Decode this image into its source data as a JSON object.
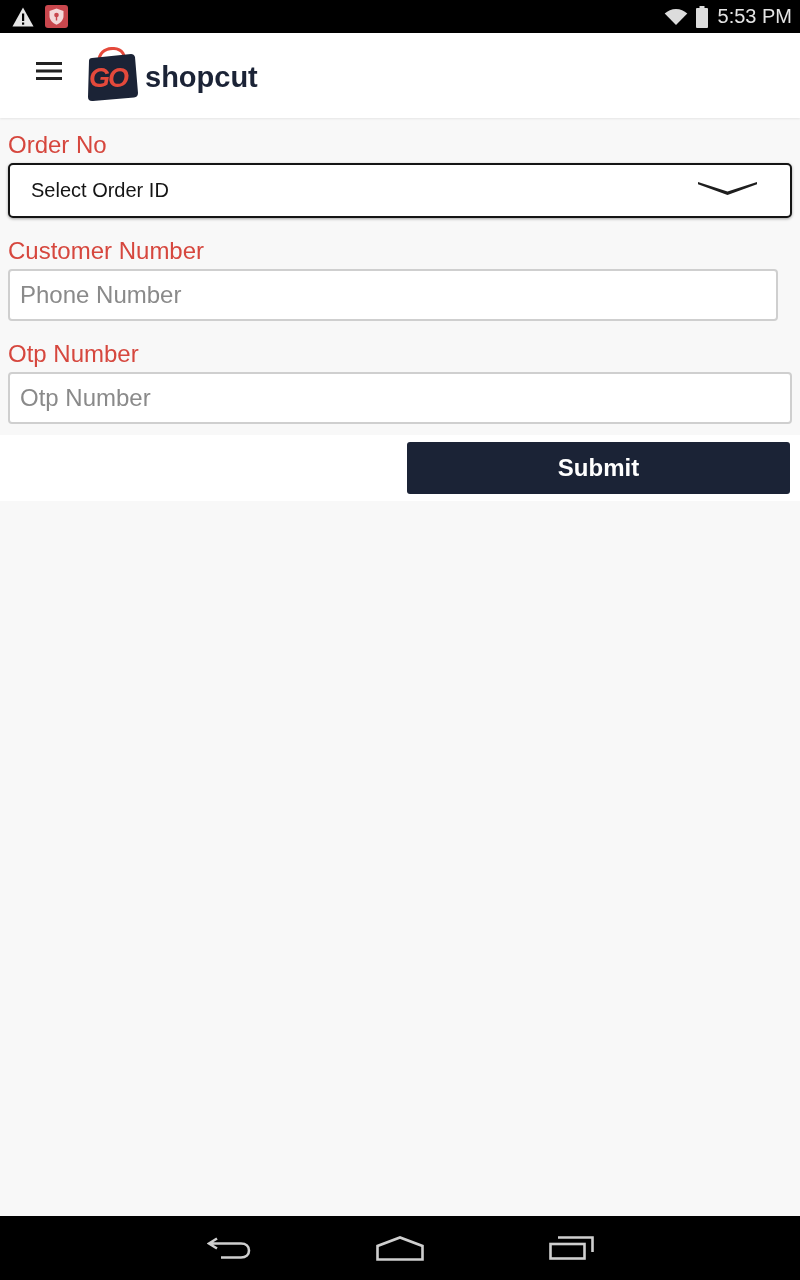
{
  "status_bar": {
    "time": "5:53 PM"
  },
  "app_bar": {
    "logo": {
      "badge": "GO",
      "name": "shopcut"
    }
  },
  "form": {
    "fields": [
      {
        "kind": "select",
        "label": "Order No",
        "value": "Select Order ID"
      },
      {
        "kind": "text",
        "label": "Customer Number",
        "placeholder": "Phone Number"
      },
      {
        "kind": "text",
        "label": "Otp Number",
        "placeholder": "Otp Number"
      }
    ],
    "submit": "Submit"
  }
}
